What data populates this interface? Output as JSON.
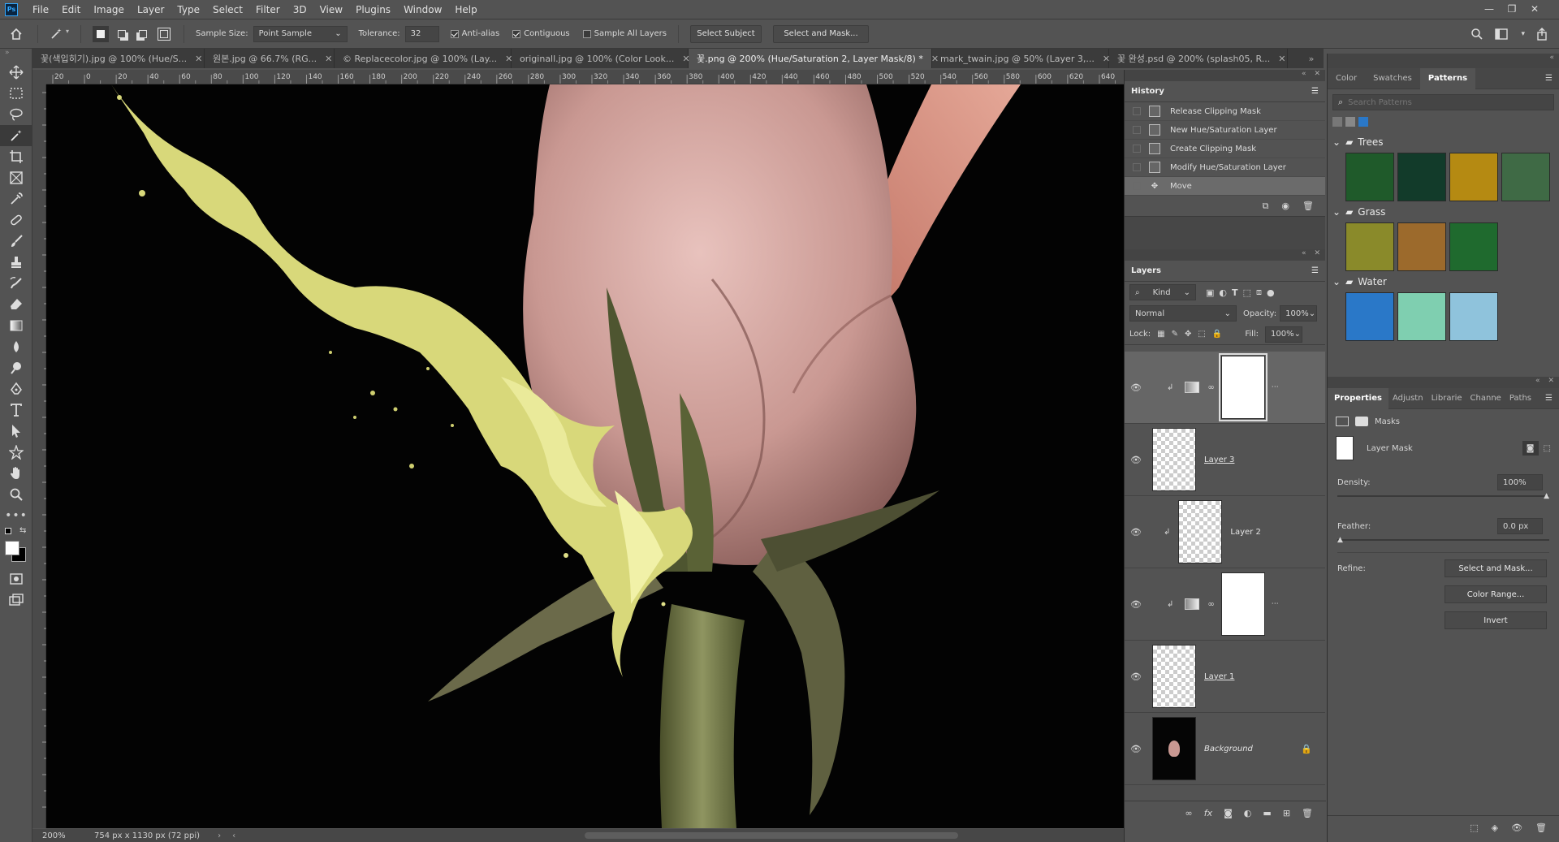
{
  "app": {
    "logo": "Ps"
  },
  "menu": [
    "File",
    "Edit",
    "Image",
    "Layer",
    "Type",
    "Select",
    "Filter",
    "3D",
    "View",
    "Plugins",
    "Window",
    "Help"
  ],
  "options": {
    "sample_size_label": "Sample Size:",
    "sample_size_value": "Point Sample",
    "tolerance_label": "Tolerance:",
    "tolerance_value": "32",
    "anti_alias": "Anti-alias",
    "contiguous": "Contiguous",
    "sample_all_layers": "Sample All Layers",
    "select_subject": "Select Subject",
    "select_and_mask": "Select and Mask..."
  },
  "tabs": [
    "꽃(색입히기).jpg @ 100% (Hue/S...",
    "원본.jpg @ 66.7% (RG...",
    "© Replacecolor.jpg @ 100% (Lay...",
    "originall.jpg @ 100% (Color Look...",
    "꽃.png @ 200% (Hue/Saturation 2, Layer Mask/8) *",
    "mark_twain.jpg @ 50% (Layer 3,...",
    "꽃 완성.psd @ 200% (splash05, R..."
  ],
  "ruler_ticks": [
    "20",
    "0",
    "20",
    "40",
    "60",
    "80",
    "100",
    "120",
    "140",
    "160",
    "180",
    "200",
    "220",
    "240",
    "260",
    "280",
    "300",
    "320",
    "340",
    "360",
    "380",
    "400",
    "420",
    "440",
    "460",
    "480",
    "500",
    "520",
    "540",
    "560",
    "580",
    "600",
    "620",
    "640"
  ],
  "status": {
    "zoom": "200%",
    "doc_info": "754 px x 1130 px (72 ppi)"
  },
  "history": {
    "title": "History",
    "items": [
      "Release Clipping Mask",
      "New Hue/Saturation Layer",
      "Create Clipping Mask",
      "Modify Hue/Saturation Layer",
      "Move"
    ]
  },
  "layers": {
    "title": "Layers",
    "kind": "Kind",
    "blend_mode": "Normal",
    "opacity_label": "Opacity:",
    "opacity_value": "100%",
    "lock_label": "Lock:",
    "fill_label": "Fill:",
    "fill_value": "100%",
    "items": [
      {
        "name": ""
      },
      {
        "name": "Layer 3"
      },
      {
        "name": "Layer 2"
      },
      {
        "name": ""
      },
      {
        "name": "Layer 1"
      },
      {
        "name": "Background"
      }
    ]
  },
  "right_tabs": [
    "Color",
    "Swatches",
    "Patterns"
  ],
  "patterns": {
    "search_placeholder": "Search Patterns",
    "groups": [
      {
        "name": "Trees",
        "colors": [
          "#1f5a2a",
          "#123b2a",
          "#b58a12",
          "#3f6a45"
        ]
      },
      {
        "name": "Grass",
        "colors": [
          "#8a8a2a",
          "#9c6a2c",
          "#1f6a2e"
        ]
      },
      {
        "name": "Water",
        "colors": [
          "#2a78c8",
          "#7fcfb0",
          "#8fc3dc"
        ]
      }
    ]
  },
  "properties": {
    "tabs": [
      "Properties",
      "Adjustn",
      "Librarie",
      "Channe",
      "Paths"
    ],
    "masks_label": "Masks",
    "layer_mask_label": "Layer Mask",
    "density_label": "Density:",
    "density_value": "100%",
    "feather_label": "Feather:",
    "feather_value": "0.0 px",
    "refine_label": "Refine:",
    "select_and_mask": "Select and Mask...",
    "color_range": "Color Range...",
    "invert": "Invert"
  }
}
